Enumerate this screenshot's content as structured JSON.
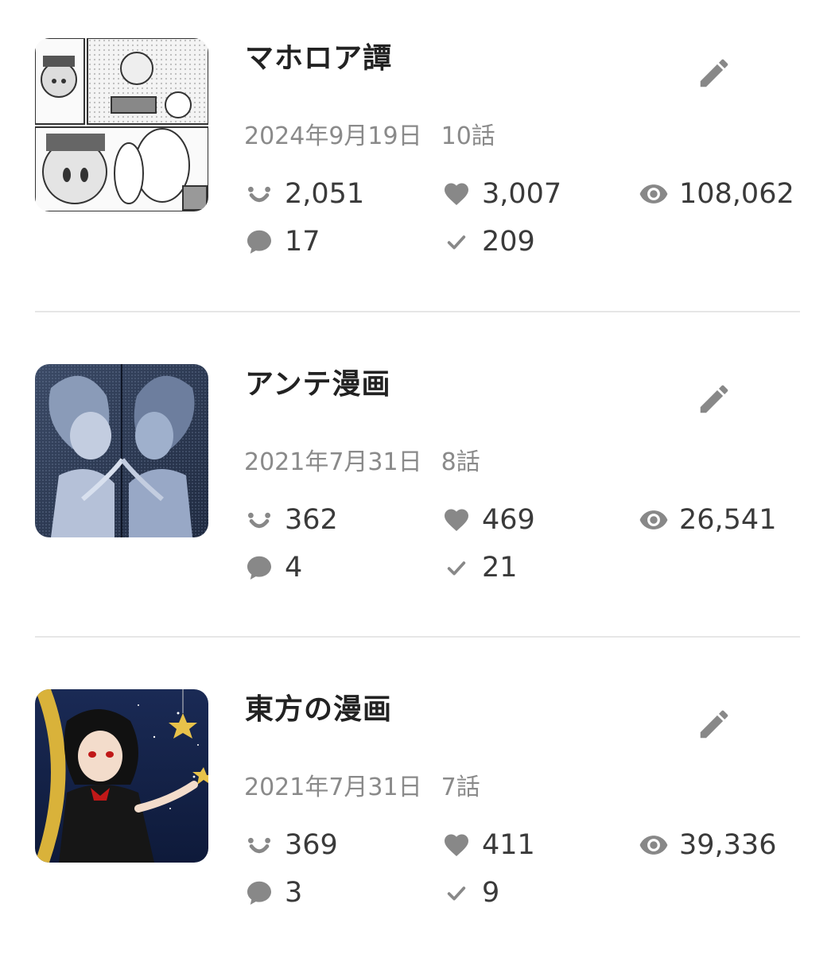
{
  "series": [
    {
      "title": "マホロア譚",
      "date": "2024年9月19日",
      "episodes": "10話",
      "stats": {
        "smiles": "2,051",
        "likes": "3,007",
        "views": "108,062",
        "comments": "17",
        "checks": "209"
      },
      "thumbnail_icon": "manga-panel-thumbnail"
    },
    {
      "title": "アンテ漫画",
      "date": "2021年7月31日",
      "episodes": "8話",
      "stats": {
        "smiles": "362",
        "likes": "469",
        "views": "26,541",
        "comments": "4",
        "checks": "21"
      },
      "thumbnail_icon": "mirror-illustration-thumbnail"
    },
    {
      "title": "東方の漫画",
      "date": "2021年7月31日",
      "episodes": "7話",
      "stats": {
        "smiles": "369",
        "likes": "411",
        "views": "39,336",
        "comments": "3",
        "checks": "9"
      },
      "thumbnail_icon": "night-sky-girl-thumbnail"
    }
  ],
  "icons": {
    "edit": "pencil-icon",
    "smiles": "smile-icon",
    "likes": "heart-icon",
    "views": "eye-icon",
    "comments": "comment-bubble-icon",
    "checks": "check-icon"
  },
  "colors": {
    "icon": "#888888",
    "meta_text": "#8a8a8a",
    "stat_text": "#3a3a3a",
    "title_text": "#222222",
    "divider": "#e6e6e6"
  }
}
